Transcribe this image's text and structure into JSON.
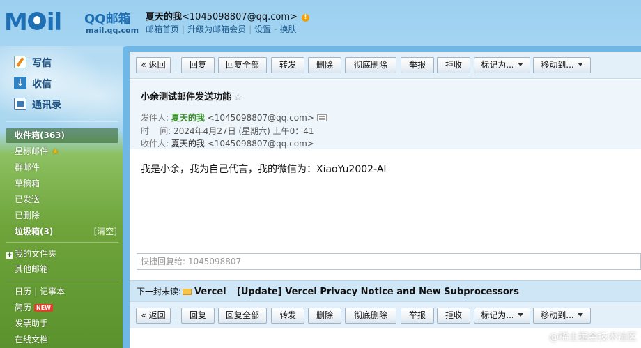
{
  "app": {
    "logo_mark": "M  il",
    "logo_name": "QQ邮箱",
    "logo_url": "mail.qq.com"
  },
  "header": {
    "user_name": "夏天的我",
    "user_email": "<1045098807@qq.com>",
    "alert_icon": "!",
    "links": [
      "邮箱首页",
      "升级为邮箱会员",
      "设置",
      "换肤"
    ],
    "link_separators": [
      "|",
      "|",
      "-"
    ]
  },
  "sidebar": {
    "actions": [
      {
        "label": "写信",
        "icon": "write-icon"
      },
      {
        "label": "收信",
        "icon": "receive-icon"
      },
      {
        "label": "通讯录",
        "icon": "contacts-icon"
      }
    ],
    "folders": {
      "inbox": "收件箱(363)",
      "starred": "星标邮件",
      "starred_icon": "★",
      "group": "群邮件",
      "drafts": "草稿箱",
      "sent": "已发送",
      "deleted": "已删除",
      "spam": "垃圾箱(3)",
      "spam_clear": "[清空]",
      "my_folders": "我的文件夹",
      "other_mailboxes": "其他邮箱",
      "calendar": "日历",
      "notes": "记事本",
      "resume": "简历",
      "resume_badge": "NEW",
      "invoice": "发票助手",
      "docs": "在线文档"
    }
  },
  "toolbar": {
    "back": "« 返回",
    "reply": "回复",
    "reply_all": "回复全部",
    "forward": "转发",
    "delete": "删除",
    "perm_delete": "彻底删除",
    "report": "举报",
    "reject": "拒收",
    "mark_as": "标记为...",
    "move_to": "移动到..."
  },
  "mail": {
    "subject": "小余测试邮件发送功能",
    "star_icon": "☆",
    "from_label": "发件人:",
    "from_name": "夏天的我",
    "from_addr": "<1045098807@qq.com>",
    "time_label": "时    间:",
    "time_value": "2024年4月27日 (星期六) 上午0：41",
    "to_label": "收件人:",
    "to_name": "夏天的我",
    "to_addr": "<1045098807@qq.com>",
    "body": "我是小余，我为自己代言，我的微信为：XiaoYu2002-AI"
  },
  "quick_reply": {
    "placeholder": "快捷回复给: 1045098807"
  },
  "next_unread": {
    "label": "下一封未读:",
    "sender": "Vercel",
    "subject": "[Update] Vercel Privacy Notice and New Subprocessors"
  },
  "watermark": "@稀土掘金技术社区",
  "colors": {
    "brand_blue": "#1f6fb4",
    "sender_green": "#3a8f2a",
    "new_badge_red": "#e43b2c",
    "alert_orange": "#f2a20a"
  }
}
